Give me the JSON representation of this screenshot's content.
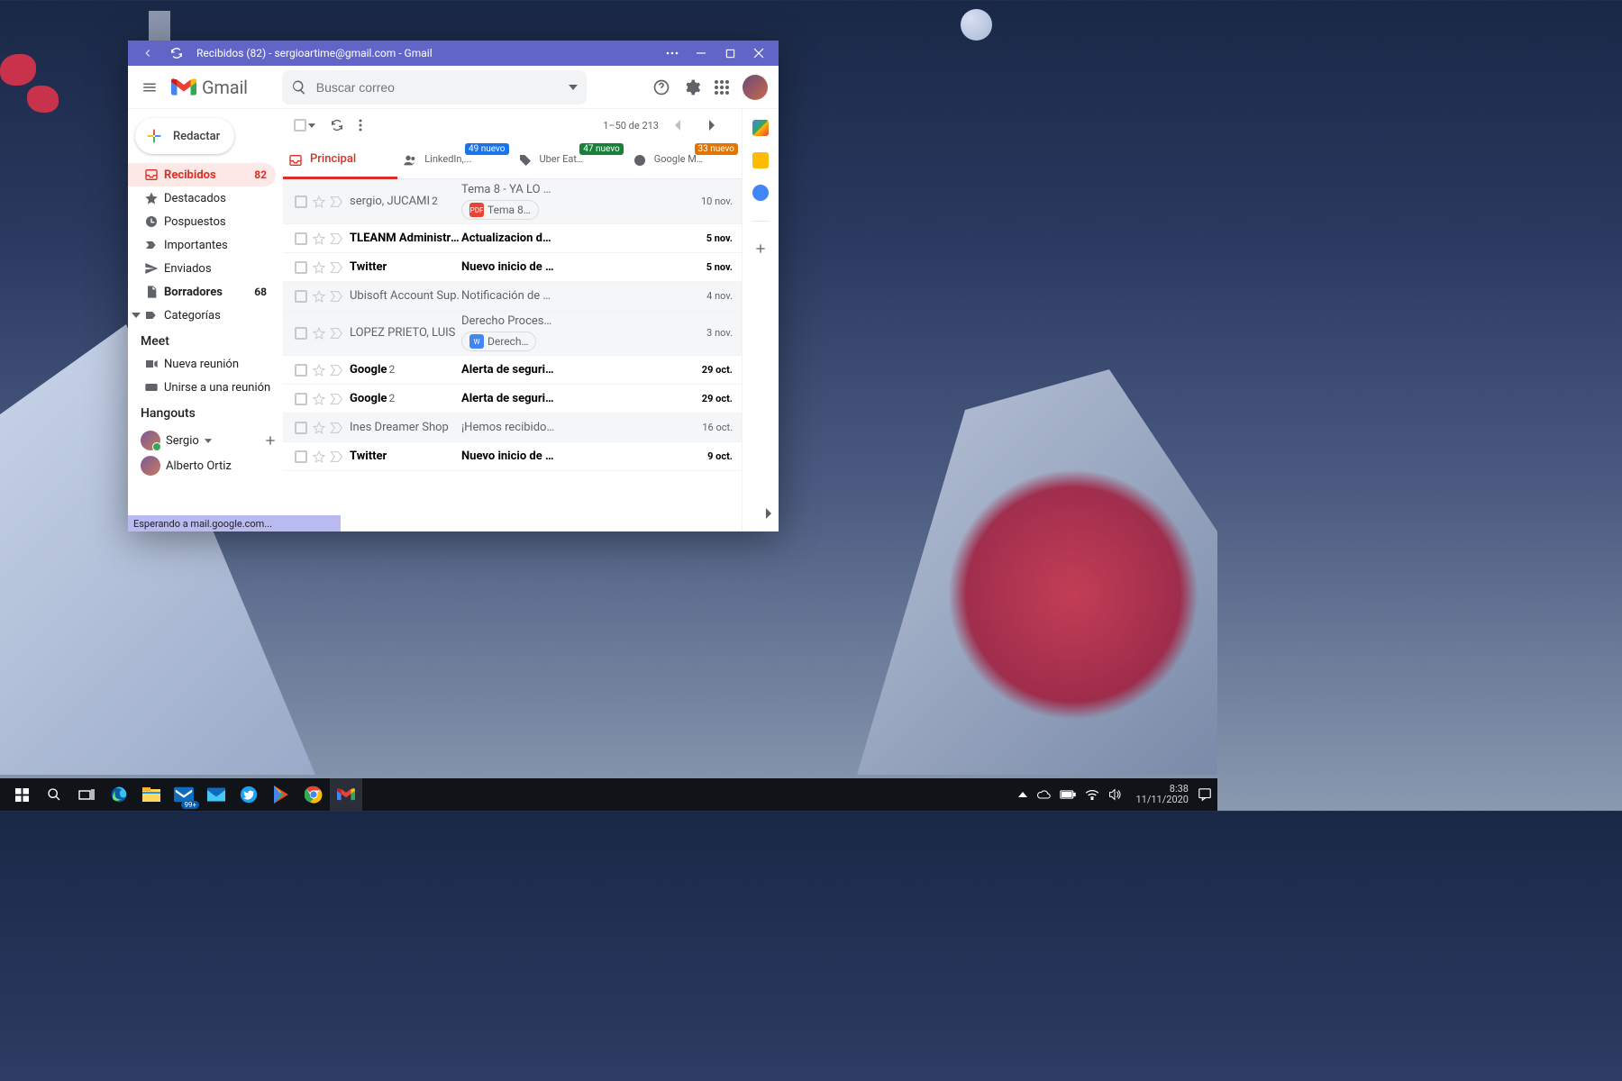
{
  "window": {
    "title": "Recibidos (82) - sergioartime@gmail.com - Gmail",
    "status": "Esperando a mail.google.com..."
  },
  "header": {
    "brand": "Gmail",
    "search_placeholder": "Buscar correo"
  },
  "sidebar": {
    "compose": "Redactar",
    "items": [
      {
        "label": "Recibidos",
        "count": "82"
      },
      {
        "label": "Destacados"
      },
      {
        "label": "Pospuestos"
      },
      {
        "label": "Importantes"
      },
      {
        "label": "Enviados"
      },
      {
        "label": "Borradores",
        "count": "68"
      },
      {
        "label": "Categorías"
      }
    ],
    "meet_header": "Meet",
    "meet": [
      {
        "label": "Nueva reunión"
      },
      {
        "label": "Unirse a una reunión"
      }
    ],
    "hangouts_header": "Hangouts",
    "hangouts_me": "Sergio",
    "hangouts_contacts": [
      {
        "name": "Alberto Ortiz"
      }
    ]
  },
  "toolbar": {
    "range": "1–50 de 213"
  },
  "tabs": [
    {
      "label": "Principal"
    },
    {
      "label": "",
      "sub": "LinkedIn,...",
      "badge": "49 nuevo",
      "color": "blue"
    },
    {
      "label": "",
      "sub": "Uber Eat…",
      "badge": "47 nuevo",
      "color": "green"
    },
    {
      "label": "",
      "sub": "Google M…",
      "badge": "33 nuevo",
      "color": "orange"
    }
  ],
  "mails": [
    {
      "read": true,
      "sender": "sergio, JUCAMI",
      "count": "2",
      "subject": "Tema 8",
      "snippet": " - YA LO …",
      "date": "10 nov.",
      "attach": {
        "type": "pdf",
        "name": "Tema 8…"
      }
    },
    {
      "read": false,
      "sender": "TLEANM Administraci.",
      "subject": "Actualizacion d…",
      "date": "5 nov."
    },
    {
      "read": false,
      "sender": "Twitter",
      "subject": "Nuevo inicio de …",
      "date": "5 nov."
    },
    {
      "read": true,
      "sender": "Ubisoft Account Sup.",
      "subject": "Notificación de …",
      "date": "4 nov."
    },
    {
      "read": true,
      "sender": "LOPEZ PRIETO, LUIS",
      "subject": "Derecho Proces…",
      "date": "3 nov.",
      "attach": {
        "type": "doc",
        "name": "Derech…"
      }
    },
    {
      "read": false,
      "sender": "Google",
      "count": "2",
      "subject": "Alerta de seguri…",
      "date": "29 oct."
    },
    {
      "read": false,
      "sender": "Google",
      "count": "2",
      "subject": "Alerta de seguri…",
      "date": "29 oct."
    },
    {
      "read": true,
      "sender": "Ines Dreamer Shop",
      "subject": "¡Hemos recibido…",
      "date": "16 oct."
    },
    {
      "read": false,
      "sender": "Twitter",
      "subject": "Nuevo inicio de …",
      "date": "9 oct."
    }
  ],
  "taskbar": {
    "badge": "99+",
    "time": "8:38",
    "date": "11/11/2020"
  }
}
